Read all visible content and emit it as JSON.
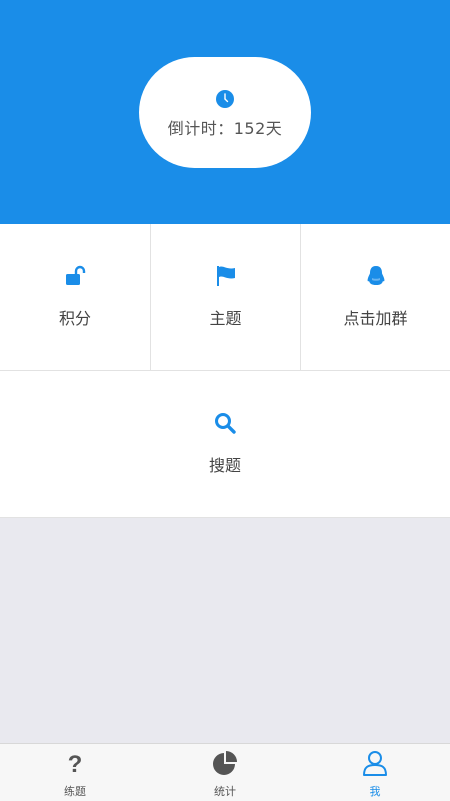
{
  "header": {
    "countdown_text": "倒计时：152天",
    "clock_icon": "clock-icon"
  },
  "menu": [
    {
      "label": "积分",
      "icon": "unlock-icon"
    },
    {
      "label": "主题",
      "icon": "flag-icon"
    },
    {
      "label": "点击加群",
      "icon": "qq-penguin-icon"
    },
    {
      "label": "搜题",
      "icon": "search-icon"
    }
  ],
  "tabbar": {
    "tabs": [
      {
        "label": "练题",
        "icon": "question-mark-icon"
      },
      {
        "label": "统计",
        "icon": "pie-chart-icon"
      },
      {
        "label": "我",
        "icon": "user-icon"
      }
    ],
    "active": "我"
  },
  "colors": {
    "accent": "#1a8de8",
    "background": "#e9e9ef",
    "inactive_icon": "#555555"
  }
}
